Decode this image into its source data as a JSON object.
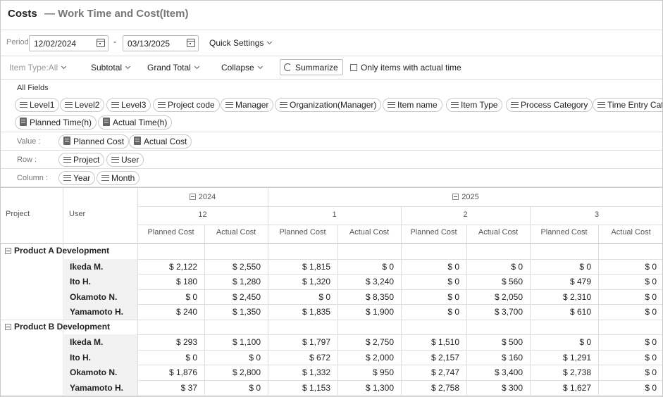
{
  "title": "Costs",
  "subtitle": "— Work Time and Cost(Item)",
  "period": {
    "label": "Period",
    "start": "12/02/2024",
    "separator": "-",
    "end": "03/13/2025",
    "quick_settings": "Quick Settings"
  },
  "options": {
    "item_type": "Item Type:All",
    "subtotal": "Subtotal",
    "grand_total": "Grand Total",
    "collapse": "Collapse",
    "summarize": "Summarize",
    "only_actual": "Only items with actual time"
  },
  "fields": {
    "label": "All Fields",
    "chips": [
      "Level1",
      "Level2",
      "Level3",
      "Project code",
      "Manager",
      "Organization(Manager)",
      "Item name",
      "Item Type",
      "Process Category",
      "Time Entry Category"
    ],
    "value_chips": [
      "Planned Time(h)",
      "Actual Time(h)"
    ]
  },
  "zones": {
    "value_label": "Value :",
    "value_chips": [
      "Planned Cost",
      "Actual Cost"
    ],
    "row_label": "Row :",
    "row_chips": [
      "Project",
      "User"
    ],
    "column_label": "Column :",
    "column_chips": [
      "Year",
      "Month"
    ]
  },
  "grid": {
    "row_headers": [
      "Project",
      "User"
    ],
    "years": [
      "2024",
      "2025"
    ],
    "months": [
      "12",
      "1",
      "2",
      "3"
    ],
    "measures": [
      "Planned Cost",
      "Actual Cost"
    ],
    "groups": [
      {
        "project": "Product A Development",
        "rows": [
          {
            "user": "Ikeda M.",
            "values": [
              "$ 2,122",
              "$ 2,550",
              "$ 1,815",
              "$ 0",
              "$ 0",
              "$ 0",
              "$ 0",
              "$ 0"
            ]
          },
          {
            "user": "Ito H.",
            "values": [
              "$ 180",
              "$ 1,280",
              "$ 1,320",
              "$ 3,240",
              "$ 0",
              "$ 560",
              "$ 479",
              "$ 0"
            ]
          },
          {
            "user": "Okamoto N.",
            "values": [
              "$ 0",
              "$ 2,450",
              "$ 0",
              "$ 8,350",
              "$ 0",
              "$ 2,050",
              "$ 2,310",
              "$ 0"
            ]
          },
          {
            "user": "Yamamoto H.",
            "values": [
              "$ 240",
              "$ 1,350",
              "$ 1,835",
              "$ 1,900",
              "$ 0",
              "$ 3,700",
              "$ 610",
              "$ 0"
            ]
          }
        ]
      },
      {
        "project": "Product B Development",
        "rows": [
          {
            "user": "Ikeda M.",
            "values": [
              "$ 293",
              "$ 1,100",
              "$ 1,797",
              "$ 2,750",
              "$ 1,510",
              "$ 500",
              "$ 0",
              "$ 0"
            ]
          },
          {
            "user": "Ito H.",
            "values": [
              "$ 0",
              "$ 0",
              "$ 672",
              "$ 2,000",
              "$ 2,157",
              "$ 160",
              "$ 1,291",
              "$ 0"
            ]
          },
          {
            "user": "Okamoto N.",
            "values": [
              "$ 1,876",
              "$ 2,800",
              "$ 1,332",
              "$ 950",
              "$ 2,747",
              "$ 3,400",
              "$ 2,738",
              "$ 0"
            ]
          },
          {
            "user": "Yamamoto H.",
            "values": [
              "$ 37",
              "$ 0",
              "$ 1,153",
              "$ 1,300",
              "$ 2,758",
              "$ 300",
              "$ 1,627",
              "$ 0"
            ]
          }
        ]
      }
    ]
  }
}
